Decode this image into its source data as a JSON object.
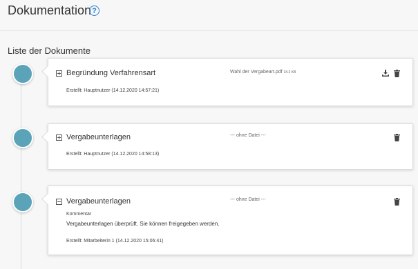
{
  "header": {
    "title": "Dokumentation",
    "help_icon": "question-circle-icon"
  },
  "list": {
    "title": "Liste der Dokumente",
    "items": [
      {
        "title": "Begründung Verfahrensart",
        "file_name": "Wahl der Vergabeart.pdf",
        "file_size": "34.3 KB",
        "created": "Erstellt: Hauptnutzer (14.12.2020 14:57:21)",
        "expanded": false,
        "icons": [
          "download-icon",
          "trash-icon"
        ]
      },
      {
        "title": "Vergabeunterlagen",
        "file_name": "--- ohne Datei ---",
        "created": "Erstellt: Hauptnutzer (14.12.2020 14:58:13)",
        "expanded": false,
        "icons": [
          "trash-icon"
        ]
      },
      {
        "title": "Vergabeunterlagen",
        "file_name": "--- ohne Datei ---",
        "comment_label": "Kommentar",
        "comment": "Vergabeunterlagen überprüft. Sie können freigegeben werden.",
        "created": "Erstellt: Mitarbeiterin 1 (14.12.2020 15:06:41)",
        "expanded": true,
        "icons": [
          "trash-icon"
        ]
      }
    ]
  },
  "colors": {
    "accent": "#2b7fd4",
    "timeline_dot": "#5aa3b8"
  }
}
